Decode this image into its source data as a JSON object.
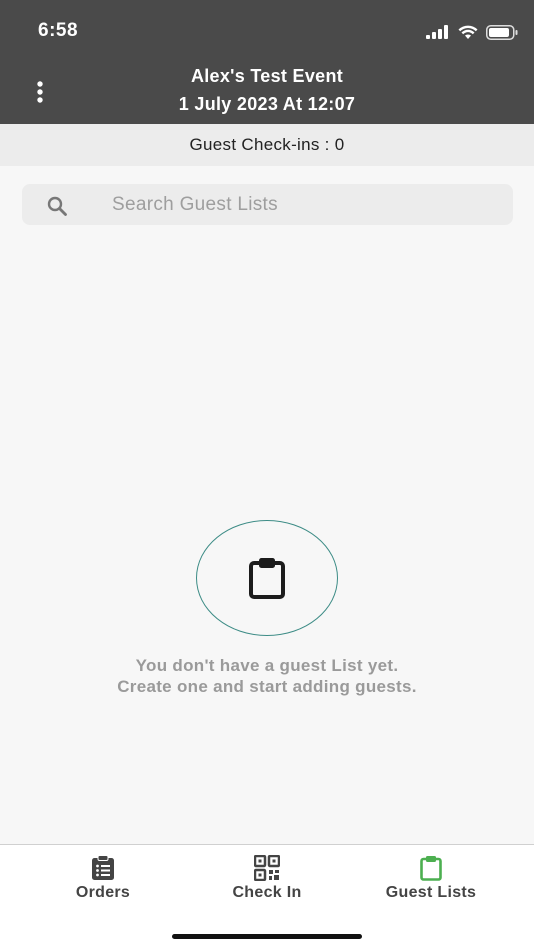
{
  "status_bar": {
    "time": "6:58",
    "icons": [
      "signal-icon",
      "wifi-icon",
      "battery-icon"
    ]
  },
  "header": {
    "menu_icon": "more-vertical-icon",
    "event_title": "Alex's Test Event",
    "event_date": "1 July 2023 At 12:07"
  },
  "checkins": {
    "label": "Guest Check-ins : 0"
  },
  "search": {
    "icon": "search-icon",
    "placeholder": "Search Guest Lists",
    "value": ""
  },
  "empty_state": {
    "icon": "clipboard-icon",
    "line1": "You don't have a guest List yet.",
    "line2": "Create one and start adding guests."
  },
  "bottom_nav": {
    "items": [
      {
        "label": "Orders",
        "icon": "clipboard-list-icon",
        "active": false
      },
      {
        "label": "Check In",
        "icon": "qr-code-icon",
        "active": false
      },
      {
        "label": "Guest Lists",
        "icon": "clipboard-icon",
        "active": true
      }
    ]
  },
  "colors": {
    "header_bg": "#4a4a4a",
    "accent_green": "#4caf50",
    "circle_teal": "#3d8c86",
    "muted_text": "#9a9a9a"
  }
}
